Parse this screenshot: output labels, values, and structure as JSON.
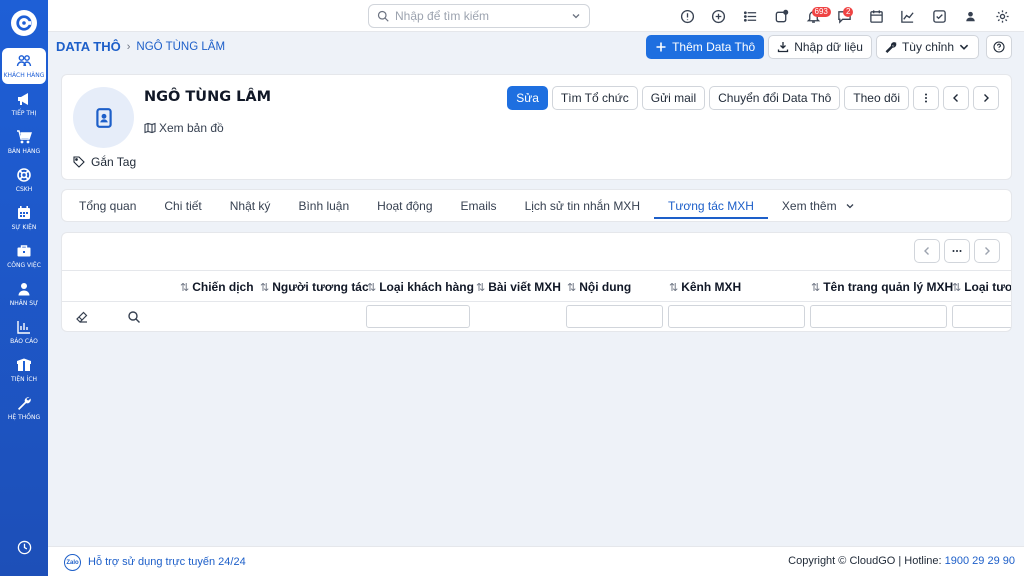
{
  "sidebar": {
    "items": [
      {
        "label": "KHÁCH HÀNG",
        "icon": "users-icon",
        "active": true
      },
      {
        "label": "TIẾP THỊ",
        "icon": "megaphone-icon"
      },
      {
        "label": "BÁN HÀNG",
        "icon": "cart-icon"
      },
      {
        "label": "CSKH",
        "icon": "lifebuoy-icon"
      },
      {
        "label": "SỰ KIỆN",
        "icon": "calendar-icon"
      },
      {
        "label": "CÔNG VIỆC",
        "icon": "briefcase-icon"
      },
      {
        "label": "NHÂN SỰ",
        "icon": "person-icon"
      },
      {
        "label": "BÁO CÁO",
        "icon": "report-icon"
      },
      {
        "label": "TIỆN ÍCH",
        "icon": "box-icon"
      },
      {
        "label": "HỆ THỐNG",
        "icon": "wrench-icon"
      }
    ]
  },
  "topbar": {
    "search_placeholder": "Nhập để tìm kiếm",
    "notifications_badge": "693",
    "messages_badge": "2"
  },
  "breadcrumb": {
    "root": "DATA THÔ",
    "current": "NGÔ TÙNG LÂM"
  },
  "header_actions": {
    "add": "Thêm Data Thô",
    "import": "Nhập dữ liệu",
    "customize": "Tùy chỉnh"
  },
  "record": {
    "name": "NGÔ TÙNG LÂM",
    "map_link": "Xem bản đồ",
    "tag_label": "Gắn Tag",
    "actions": {
      "edit": "Sửa",
      "find_org": "Tìm Tổ chức",
      "send_mail": "Gửi mail",
      "convert": "Chuyển đổi Data Thô",
      "follow": "Theo dõi"
    }
  },
  "tabs": [
    {
      "label": "Tổng quan"
    },
    {
      "label": "Chi tiết"
    },
    {
      "label": "Nhật ký"
    },
    {
      "label": "Bình luận"
    },
    {
      "label": "Hoạt động"
    },
    {
      "label": "Emails"
    },
    {
      "label": "Lịch sử tin nhắn MXH"
    },
    {
      "label": "Tương tác MXH",
      "active": true
    },
    {
      "label": "Xem thêm"
    }
  ],
  "table": {
    "columns": [
      "Chiến dịch",
      "Người tương tác",
      "Loại khách hàng",
      "Bài viết MXH",
      "Nội dung",
      "Kênh MXH",
      "Tên trang quản lý MXH",
      "Loại tương"
    ]
  },
  "footer": {
    "zalo": "Zalo",
    "support": "Hỗ trợ sử dụng trực tuyến 24/24",
    "copyright": "Copyright © CloudGO | Hotline: ",
    "hotline": "1900 29 29 90"
  }
}
